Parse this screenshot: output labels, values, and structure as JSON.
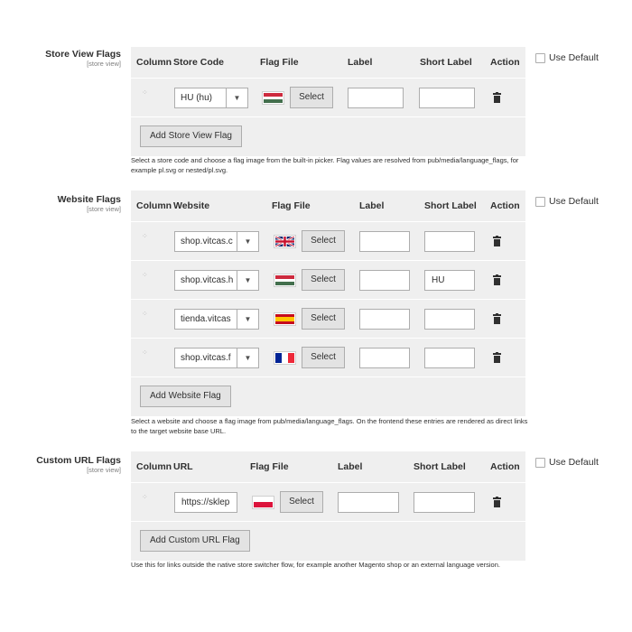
{
  "store_view_flags": {
    "title": "Store View Flags",
    "scope": "[store view]",
    "headers": [
      "Column",
      "Store Code",
      "Flag File",
      "Label",
      "Short Label",
      "Action"
    ],
    "rows": [
      {
        "select_value": "HU (hu)",
        "flag": "hungary",
        "select_button": "Select",
        "label": "",
        "short_label": ""
      }
    ],
    "add_button": "Add Store View Flag",
    "note": "Select a store code and choose a flag image from the built-in picker. Flag values are resolved from pub/media/language_flags, for example pl.svg or nested/pl.svg.",
    "use_default": "Use Default"
  },
  "website_flags": {
    "title": "Website Flags",
    "scope": "[store view]",
    "headers": [
      "Column",
      "Website",
      "Flag File",
      "Label",
      "Short Label",
      "Action"
    ],
    "rows": [
      {
        "select_value": "shop.vitcas.c",
        "flag": "united-kingdom",
        "select_button": "Select",
        "label": "",
        "short_label": ""
      },
      {
        "select_value": "shop.vitcas.h",
        "flag": "hungary",
        "select_button": "Select",
        "label": "",
        "short_label": "HU"
      },
      {
        "select_value": "tienda.vitcas",
        "flag": "spain",
        "select_button": "Select",
        "label": "",
        "short_label": ""
      },
      {
        "select_value": "shop.vitcas.f",
        "flag": "france",
        "select_button": "Select",
        "label": "",
        "short_label": ""
      }
    ],
    "add_button": "Add Website Flag",
    "note": "Select a website and choose a flag image from pub/media/language_flags. On the frontend these entries are rendered as direct links to the target website base URL.",
    "use_default": "Use Default"
  },
  "custom_url_flags": {
    "title": "Custom URL Flags",
    "scope": "[store view]",
    "headers": [
      "Column",
      "URL",
      "Flag File",
      "Label",
      "Short Label",
      "Action"
    ],
    "rows": [
      {
        "url_value": "https://sklep",
        "flag": "poland",
        "select_button": "Select",
        "label": "",
        "short_label": ""
      }
    ],
    "add_button": "Add Custom URL Flag",
    "note": "Use this for links outside the native store switcher flow, for example another Magento shop or an external language version.",
    "use_default": "Use Default"
  },
  "icons": {
    "drag": "drag-handle-icon",
    "dropdown": "chevron-down-icon",
    "delete": "trash-icon"
  },
  "colors": {
    "grid_background": "#efefef",
    "button_background": "#e3e3e3",
    "border": "#adadad",
    "text": "#303030"
  }
}
